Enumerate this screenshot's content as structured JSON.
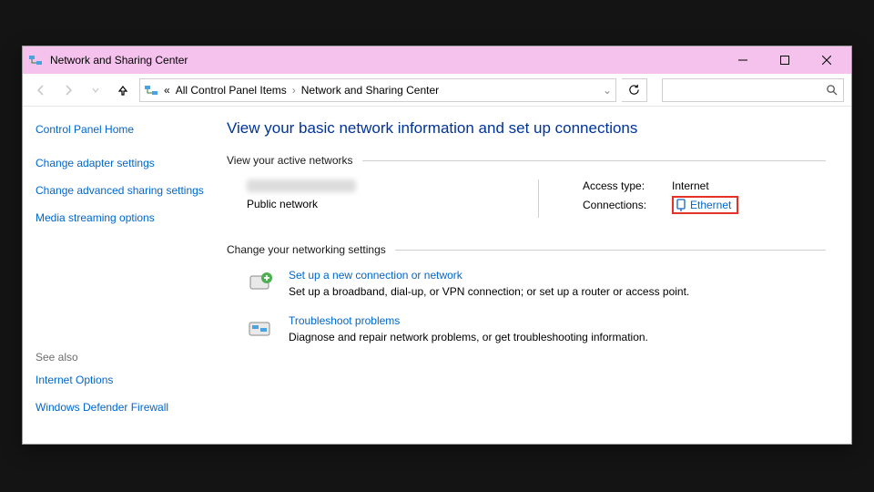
{
  "window": {
    "title": "Network and Sharing Center"
  },
  "breadcrumbs": {
    "prefix": "«",
    "item1": "All Control Panel Items",
    "item2": "Network and Sharing Center"
  },
  "sidebar": {
    "home": "Control Panel Home",
    "links": {
      "adapter": "Change adapter settings",
      "advanced": "Change advanced sharing settings",
      "media": "Media streaming options"
    },
    "seealso_label": "See also",
    "seealso": {
      "internet": "Internet Options",
      "firewall": "Windows Defender Firewall"
    }
  },
  "main": {
    "heading": "View your basic network information and set up connections",
    "active_networks_label": "View your active networks",
    "network": {
      "category": "Public network",
      "access_label": "Access type:",
      "access_value": "Internet",
      "connections_label": "Connections:",
      "connections_value": "Ethernet"
    },
    "change_settings_label": "Change your networking settings",
    "tasks": {
      "setup": {
        "title": "Set up a new connection or network",
        "desc": "Set up a broadband, dial-up, or VPN connection; or set up a router or access point."
      },
      "troubleshoot": {
        "title": "Troubleshoot problems",
        "desc": "Diagnose and repair network problems, or get troubleshooting information."
      }
    }
  }
}
